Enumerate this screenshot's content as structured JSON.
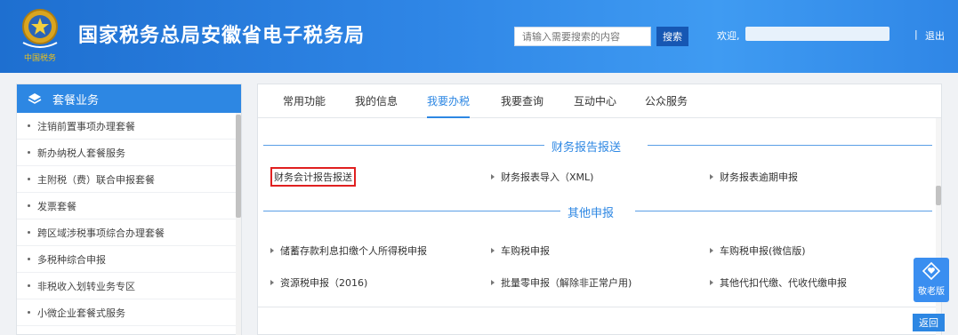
{
  "header": {
    "site_title": "国家税务总局安徽省电子税务局",
    "emblem_caption": "中国税务",
    "search_placeholder": "请输入需要搜索的内容",
    "search_button": "搜索",
    "welcome": "欢迎,",
    "separator": "|",
    "logout": "退出"
  },
  "sidebar": {
    "title": "套餐业务",
    "items": [
      {
        "label": "注销前置事项办理套餐"
      },
      {
        "label": "新办纳税人套餐服务"
      },
      {
        "label": "主附税（费）联合申报套餐"
      },
      {
        "label": "发票套餐"
      },
      {
        "label": "跨区域涉税事项综合办理套餐"
      },
      {
        "label": "多税种综合申报"
      },
      {
        "label": "非税收入划转业务专区"
      },
      {
        "label": "小微企业套餐式服务"
      }
    ]
  },
  "tabs": [
    {
      "label": "常用功能"
    },
    {
      "label": "我的信息"
    },
    {
      "label": "我要办税",
      "active": true
    },
    {
      "label": "我要查询"
    },
    {
      "label": "互动中心"
    },
    {
      "label": "公众服务"
    }
  ],
  "sections": [
    {
      "title": "财务报告报送",
      "items": [
        {
          "label": "财务会计报告报送",
          "highlighted": true
        },
        {
          "label": "财务报表导入（XML)"
        },
        {
          "label": "财务报表逾期申报"
        }
      ]
    },
    {
      "title": "其他申报",
      "items": [
        {
          "label": "储蓄存款利息扣缴个人所得税申报"
        },
        {
          "label": "车购税申报"
        },
        {
          "label": "车购税申报(微信版)"
        },
        {
          "label": "资源税申报（2016)"
        },
        {
          "label": "批量零申报（解除非正常户用)"
        },
        {
          "label": "其他代扣代缴、代收代缴申报"
        }
      ]
    }
  ],
  "float_button": {
    "label": "敬老版",
    "icon": "heart-diamond-icon"
  },
  "back_button": "返回",
  "colors": {
    "primary": "#2d87e3",
    "header": "#1e6fd0",
    "highlight_border": "#e02020"
  }
}
